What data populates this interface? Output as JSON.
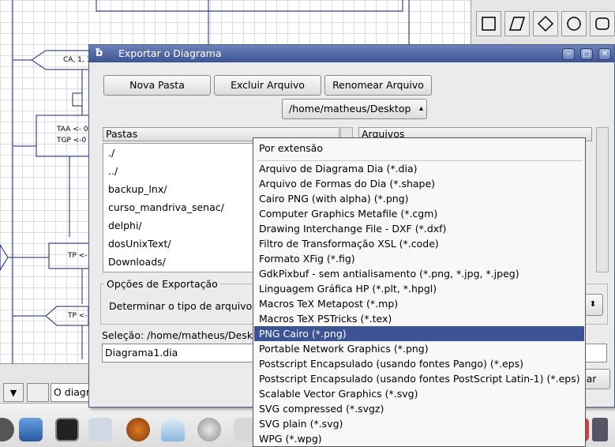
{
  "dialog": {
    "title": "Exportar o Diagrama",
    "new_folder": "Nova Pasta",
    "delete_file": "Excluir Arquivo",
    "rename_file": "Renomear Arquivo",
    "path": "/home/matheus/Desktop",
    "folders_header": "Pastas",
    "files_header": "Arquivos",
    "folders": [
      "./",
      "../",
      "backup_lnx/",
      "curso_mandriva_senac/",
      "delphi/",
      "dosUnixText/",
      "Downloads/"
    ],
    "export_options_label": "Opções de Exportação",
    "file_type_label": "Determinar o tipo de arquivo:",
    "selection_label": "Seleção: /home/matheus/Deskt",
    "filename": "Diagrama1.dia",
    "save_label": "ar"
  },
  "popup": {
    "first": "Por extensão",
    "items": [
      "Arquivo de Diagrama Dia (*.dia)",
      "Arquivo de Formas do Dia (*.shape)",
      "Cairo PNG (with alpha) (*.png)",
      "Computer Graphics Metafile (*.cgm)",
      "Drawing Interchange File - DXF (*.dxf)",
      "Filtro de Transformação XSL (*.code)",
      "Formato XFig (*.fig)",
      "GdkPixbuf - sem antialisamento (*.png, *.jpg, *.jpeg)",
      "Linguagem Gráfica HP (*.plt, *.hpgl)",
      "Macros TeX Metapost (*.mp)",
      "Macros TeX PSTricks (*.tex)",
      "PNG Cairo (*.png)",
      "Portable Network Graphics (*.png)",
      "Postscript Encapsulado (usando fontes Pango) (*.eps)",
      "Postscript Encapsulado (usando fontes PostScript Latin-1) (*.eps)",
      "Scalable Vector Graphics (*.svg)",
      "SVG compressed (*.svgz)",
      "SVG plain (*.svg)",
      "WPG (*.wpg)"
    ],
    "selected_index": 11
  },
  "canvas": {
    "t1": "CA, 1, 1",
    "t2": "TAA <- 0",
    "t3": "TGP <-0",
    "t4": "TP <-",
    "t5": "TP <-"
  },
  "statusbar": {
    "diagram_tab": "O diagr"
  },
  "colors": {
    "titlebar": "#3c5496",
    "selection": "#3c5496",
    "diagram_line": "#1a237e"
  }
}
